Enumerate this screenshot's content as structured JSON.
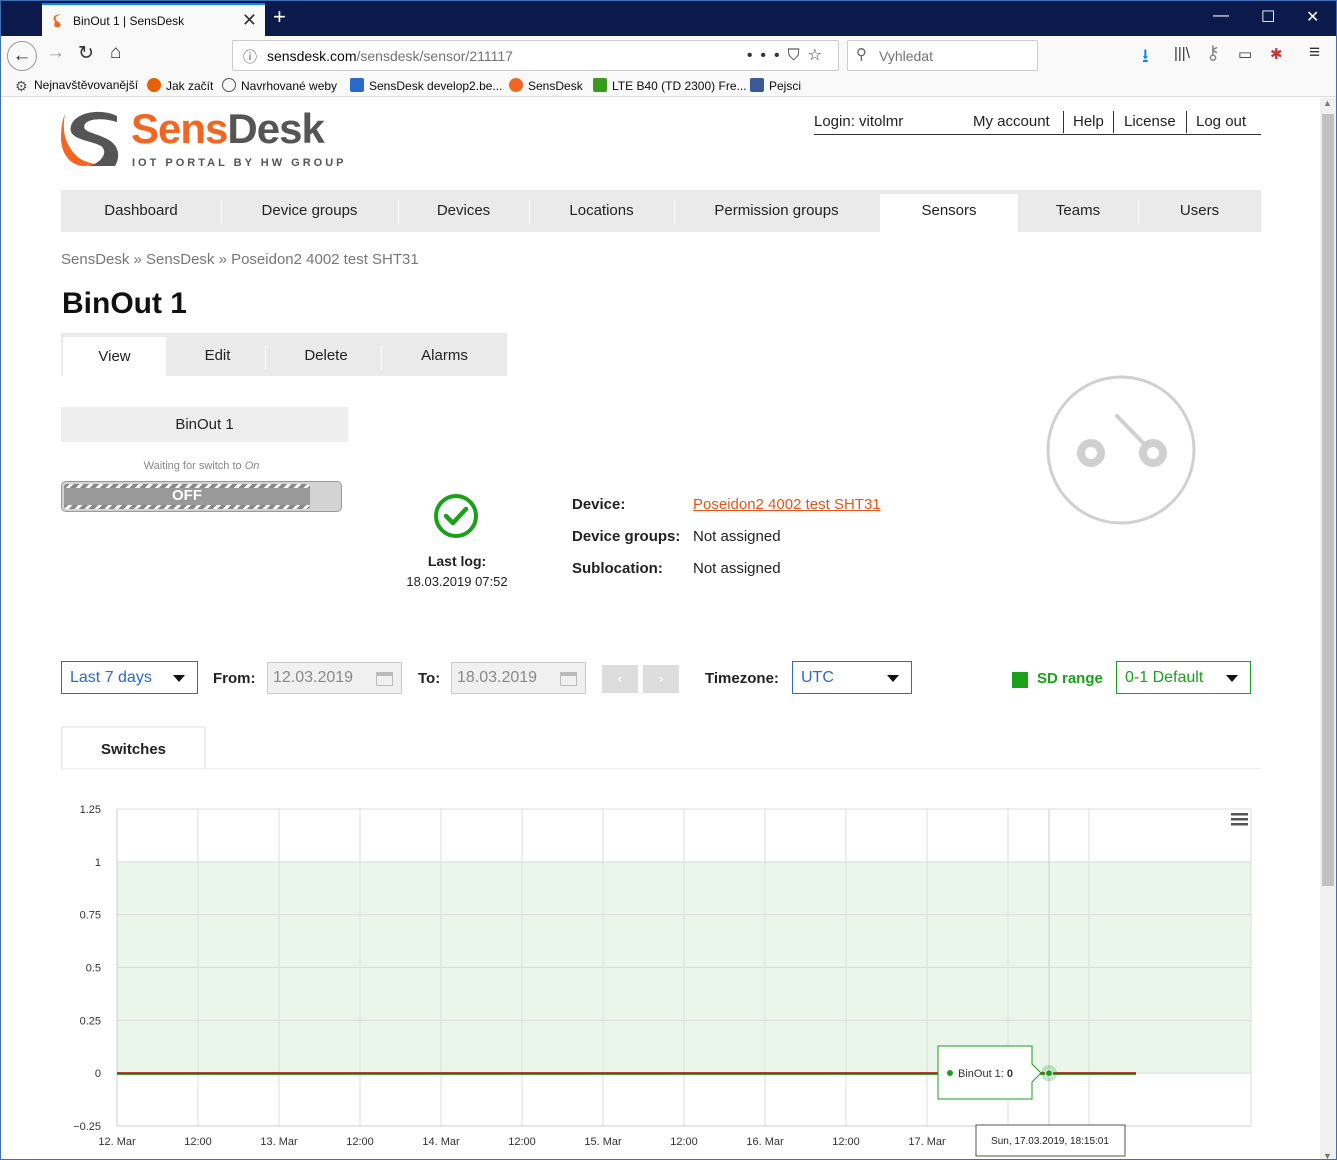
{
  "browser": {
    "tab_title": "BinOut 1 | SensDesk",
    "url_host": "sensdesk.com",
    "url_path": "/sensdesk/sensor/211117",
    "search_placeholder": "Vyhledat",
    "bookmarks": [
      {
        "label": "Nejnavštěvovanější",
        "icon": "gear-icon",
        "color": "#555"
      },
      {
        "label": "Jak začít",
        "icon": "firefox-icon",
        "color": "#e66000"
      },
      {
        "label": "Navrhované weby",
        "icon": "globe-icon",
        "color": "#555"
      },
      {
        "label": "SensDesk develop2.be...",
        "icon": "document-icon",
        "color": "#2a6acb"
      },
      {
        "label": "SensDesk",
        "icon": "sensdesk-icon",
        "color": "#f26522"
      },
      {
        "label": "LTE B40 (TD 2300) Fre...",
        "icon": "signal-icon",
        "color": "#3a9a1a"
      },
      {
        "label": "Pejsci",
        "icon": "facebook-icon",
        "color": "#3b5998"
      }
    ]
  },
  "header": {
    "logo_sens": "Sens",
    "logo_desk": "Desk",
    "logo_subtitle": "IOT PORTAL BY HW GROUP",
    "login": "Login: vitolmr",
    "my_account": "My account",
    "help": "Help",
    "license": "License",
    "logout": "Log out"
  },
  "nav": {
    "items": [
      "Dashboard",
      "Device groups",
      "Devices",
      "Locations",
      "Permission groups",
      "Sensors",
      "Teams",
      "Users"
    ],
    "active": "Sensors"
  },
  "breadcrumb": "SensDesk » SensDesk » Poseidon2 4002 test SHT31",
  "page_title": "BinOut 1",
  "subtabs": [
    "View",
    "Edit",
    "Delete",
    "Alarms"
  ],
  "switch": {
    "name": "BinOut 1",
    "waiting_text": "Waiting for switch to ",
    "waiting_state": "On",
    "state_label": "OFF"
  },
  "status": {
    "last_log_label": "Last log:",
    "last_log_value": "18.03.2019 07:52",
    "ok_color": "#1aa01a"
  },
  "details": {
    "device_label": "Device:",
    "device_value": "Poseidon2 4002 test SHT31",
    "groups_label": "Device groups:",
    "groups_value": "Not assigned",
    "subloc_label": "Sublocation:",
    "subloc_value": "Not assigned"
  },
  "controls": {
    "range": "Last 7 days",
    "from_label": "From:",
    "from_value": "12.03.2019",
    "to_label": "To:",
    "to_value": "18.03.2019",
    "prev": "‹",
    "next": "›",
    "timezone_label": "Timezone:",
    "timezone_value": "UTC",
    "sd_range_label": "SD range",
    "sd_range_value": "0-1 Default"
  },
  "chart_tab": "Switches",
  "chart_data": {
    "type": "line",
    "y_ticks": [
      "1.25",
      "1",
      "0.75",
      "0.5",
      "0.25",
      "0",
      "−0.25"
    ],
    "ylim": [
      -0.25,
      1.25
    ],
    "x_ticks": [
      "12. Mar",
      "12:00",
      "13. Mar",
      "12:00",
      "14. Mar",
      "12:00",
      "15. Mar",
      "12:00",
      "16. Mar",
      "12:00",
      "17. Mar",
      "",
      "12:00"
    ],
    "safe_range": [
      0,
      1
    ],
    "series": [
      {
        "name": "BinOut 1",
        "values": [
          0,
          0
        ],
        "x": [
          "12.03.2019",
          "17.03.2019 23:00"
        ]
      }
    ],
    "tooltip_series": "BinOut 1",
    "tooltip_value": "0",
    "tooltip_time": "Sun, 17.03.2019, 18:15:01",
    "line_color": "#b22222",
    "range_color": "#eaf6ea"
  }
}
